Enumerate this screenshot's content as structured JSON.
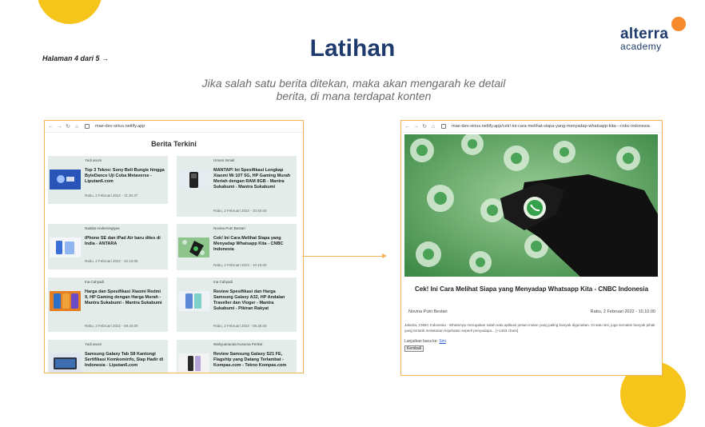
{
  "slide": {
    "page_indicator": "Halaman 4 dari 5 →",
    "title": "Latihan",
    "subtitle": "Jika salah satu berita ditekan, maka akan mengarah ke detail berita, di mana terdapat konten",
    "logo": {
      "word": "alterra",
      "sub": "academy"
    },
    "colors": {
      "accent": "#f6c51b",
      "logo_dot": "#f5892b",
      "title": "#1f3b6e",
      "frame": "#f3b354"
    }
  },
  "left_browser": {
    "url": "mae-dev-sirius.netlify.app",
    "heading": "Berita Terkini",
    "cards": [
      {
        "author": "Yudi anom",
        "headline": "Top 3 Tekno: Sony Beli Bungie hingga ByteDance Uji Coba Metaverse - Liputan6.com",
        "date": "Rabu, 2 Februari 2022 - 11.30.37",
        "thumb_icon": "playstation-icon"
      },
      {
        "author": "Umum Ismail",
        "headline": "MANTAP! Ini Spesifikasi Lengkap Xiaomi Mi 10T 5G, HP Gaming Murah Meriah dengan RAM 8GB - Mantra Sukabumi - Mantra Sukabumi",
        "date": "Rabu, 2 Februari 2022 - 10.50.00",
        "thumb_icon": "phone-icon"
      },
      {
        "author": "Natalia Anderningtyas",
        "headline": "iPhone SE dan iPad Air baru dites di India - ANTARA",
        "date": "Rabu, 2 Februari 2022 - 10.10.05",
        "thumb_icon": "iphone-icon"
      },
      {
        "author": "Novina Putri Bestari",
        "headline": "Cek! Ini Cara Melihat Siapa yang Menyadap Whatsapp Kita - CNBC Indonesia",
        "date": "Rabu, 2 Februari 2022 - 10.10.00",
        "thumb_icon": "whatsapp-icon"
      },
      {
        "author": "Ina Cahyadi",
        "headline": "Harga dan Spesifikasi Xiaomi Redmi 9, HP Gaming dengan Harga Murah - Mantra Sukabumi - Mantra Sukabumi",
        "date": "Rabu, 2 Februari 2022 - 09.40.00",
        "thumb_icon": "redmi-icon"
      },
      {
        "author": "Ina Cahyadi",
        "headline": "Review Spesifikasi dan Harga Samsung Galaxy A32, HP Andalan Traveller dan Vloger - Mantra Sukabumi - Pikiran Rakyat",
        "date": "Rabu, 2 Februari 2022 - 09.35.00",
        "thumb_icon": "galaxy-icon"
      },
      {
        "author": "Yudi anom",
        "headline": "Samsung Galaxy Tab S8 Kantongi Sertifikasi Komkominfo, Siap Hadir di Indonesia - Liputan6.com",
        "date": "",
        "thumb_icon": "tablet-icon"
      },
      {
        "author": "Wahyuananda Kusuma Pertiwi",
        "headline": "Review Samsung Galaxy S21 FE, Flagship yang Datang Terlambat - Kompas.com - Tekno Kompas.com",
        "date": "",
        "thumb_icon": "galaxy-s21-icon"
      }
    ]
  },
  "right_browser": {
    "url": "mae-dev-sirius.netlify.app/cek!-ini-cara-melihat-siapa-yang-menyadap-whatsapp-kita---cnbc-indonesia",
    "title": "Cek! Ini Cara Melihat Siapa yang Menyadap Whatsapp Kita - CNBC Indonesia",
    "author": "Novina Putri Bestari",
    "date": "Rabu, 2 Februari 2022 - 10.10.00",
    "body": "Jakarta, CNBC Indonesia - WhatsApp merupakan salah satu aplikasi pesan instan yang paling banyak digunakan. Di satu sisi, juga semakin banyak pihak yang tertarik melakukan kejahatan seperti penyadapa... [+1463 chars]",
    "more_label": "Lanjutkan baca ke:",
    "more_link": "Sini",
    "back_button": "Kembali"
  }
}
